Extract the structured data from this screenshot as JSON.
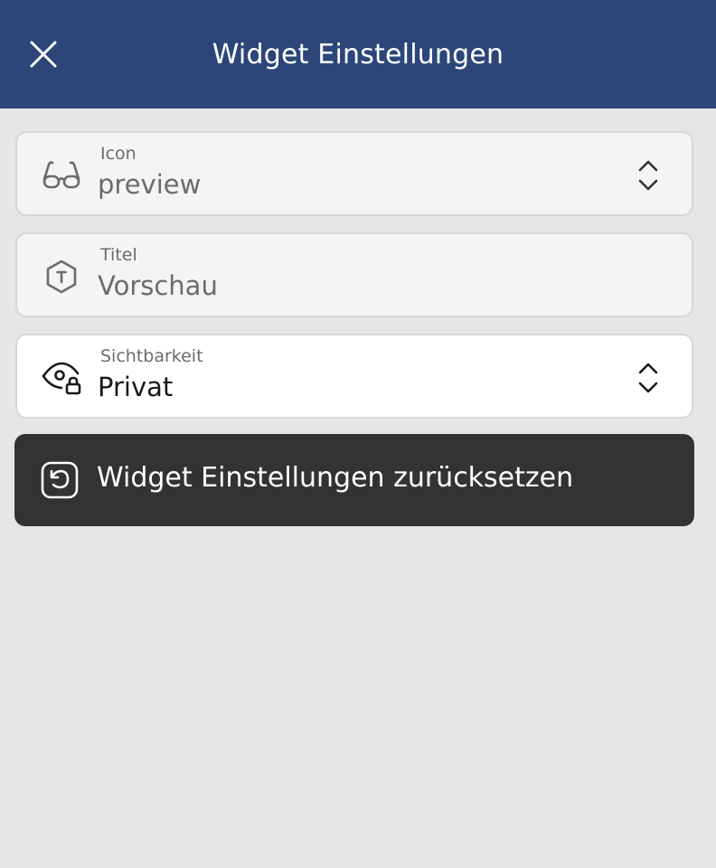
{
  "header": {
    "title": "Widget Einstellungen",
    "close_icon": "close-icon",
    "background": "#2c467a"
  },
  "fields": {
    "icon": {
      "label": "Icon",
      "value": "preview",
      "icon": "glasses-icon",
      "has_selector": true
    },
    "title": {
      "label": "Titel",
      "value": "Vorschau",
      "icon": "hexagon-t-icon",
      "has_selector": false
    },
    "visibility": {
      "label": "Sichtbarkeit",
      "value": "Privat",
      "icon": "eye-lock-icon",
      "has_selector": true
    }
  },
  "reset_button": {
    "label": "Widget Einstellungen zurücksetzen",
    "icon": "reset-icon",
    "background": "#333333"
  }
}
